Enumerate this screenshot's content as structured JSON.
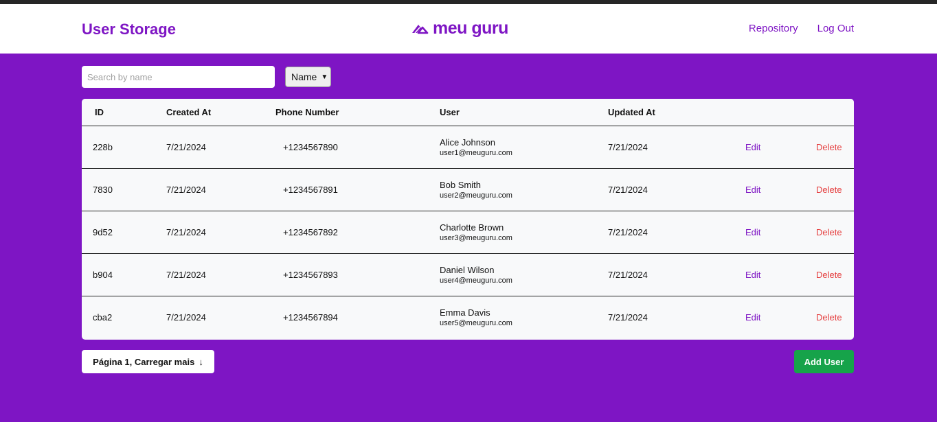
{
  "header": {
    "title": "User Storage",
    "logo_text": "meu guru",
    "nav": [
      "Repository",
      "Log Out"
    ]
  },
  "search": {
    "placeholder": "Search by name",
    "value": ""
  },
  "sort_select": {
    "selected": "Name"
  },
  "table": {
    "columns": [
      "ID",
      "Created At",
      "Phone Number",
      "User",
      "Updated At"
    ],
    "rows": [
      {
        "id": "228b",
        "created": "7/21/2024",
        "phone": "+1234567890",
        "name": "Alice Johnson",
        "email": "user1@meuguru.com",
        "updated": "7/21/2024",
        "edit": "Edit",
        "delete": "Delete"
      },
      {
        "id": "7830",
        "created": "7/21/2024",
        "phone": "+1234567891",
        "name": "Bob Smith",
        "email": "user2@meuguru.com",
        "updated": "7/21/2024",
        "edit": "Edit",
        "delete": "Delete"
      },
      {
        "id": "9d52",
        "created": "7/21/2024",
        "phone": "+1234567892",
        "name": "Charlotte Brown",
        "email": "user3@meuguru.com",
        "updated": "7/21/2024",
        "edit": "Edit",
        "delete": "Delete"
      },
      {
        "id": "b904",
        "created": "7/21/2024",
        "phone": "+1234567893",
        "name": "Daniel Wilson",
        "email": "user4@meuguru.com",
        "updated": "7/21/2024",
        "edit": "Edit",
        "delete": "Delete"
      },
      {
        "id": "cba2",
        "created": "7/21/2024",
        "phone": "+1234567894",
        "name": "Emma Davis",
        "email": "user5@meuguru.com",
        "updated": "7/21/2024",
        "edit": "Edit",
        "delete": "Delete"
      }
    ]
  },
  "footer": {
    "load_more_label": "Página 1, Carregar mais",
    "load_more_icon": "arrow-down-icon",
    "add_user_label": "Add User"
  },
  "colors": {
    "brand": "#7e15c4",
    "delete": "#e53e3e",
    "add_user": "#16a34a"
  }
}
